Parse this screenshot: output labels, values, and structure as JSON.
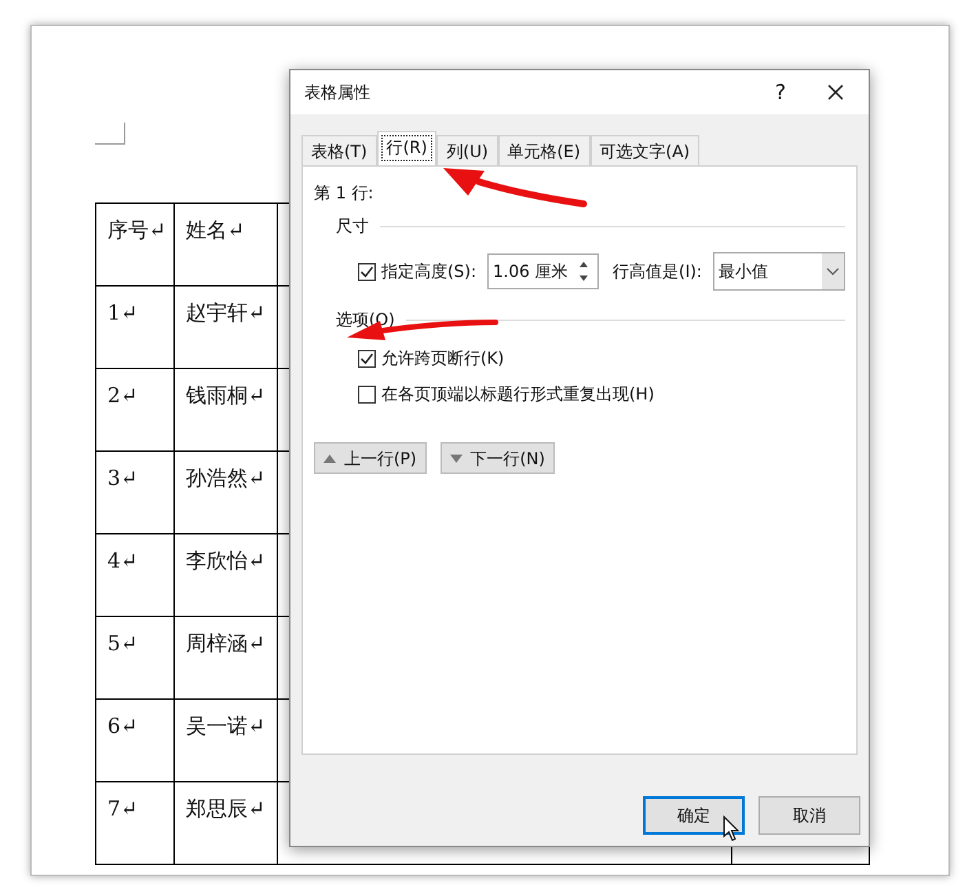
{
  "table": {
    "columns": [
      "序号↵",
      "姓名↵"
    ],
    "rows": [
      [
        "1↵",
        "赵宇轩↵"
      ],
      [
        "2↵",
        "钱雨桐↵"
      ],
      [
        "3↵",
        "孙浩然↵"
      ],
      [
        "4↵",
        "李欣怡↵"
      ],
      [
        "5↵",
        "周梓涵↵"
      ],
      [
        "6↵",
        "吴一诺↵"
      ],
      [
        "7↵",
        "郑思辰↵"
      ]
    ]
  },
  "dialog": {
    "title": "表格属性",
    "help": "?",
    "tabs": [
      {
        "label": "表格(T)",
        "selected": false
      },
      {
        "label": "行(R)",
        "selected": true
      },
      {
        "label": "列(U)",
        "selected": false
      },
      {
        "label": "单元格(E)",
        "selected": false
      },
      {
        "label": "可选文字(A)",
        "selected": false
      }
    ],
    "row_label": "第 1 行:",
    "size_section": "尺寸",
    "specify_height": {
      "label": "指定高度(S):",
      "checked": true
    },
    "height_value": "1.06 厘米",
    "row_height_label": "行高值是(I):",
    "row_height_mode": "最小值",
    "options_section": "选项(O)",
    "options": [
      {
        "label": "允许跨页断行(K)",
        "checked": true
      },
      {
        "label": "在各页顶端以标题行形式重复出现(H)",
        "checked": false
      }
    ],
    "nav_buttons": [
      {
        "label": "上一行(P)",
        "kind": "up"
      },
      {
        "label": "下一行(N)",
        "kind": "down"
      }
    ],
    "buttons": [
      {
        "label": "确定",
        "selected": true
      },
      {
        "label": "取消",
        "selected": false
      }
    ]
  }
}
